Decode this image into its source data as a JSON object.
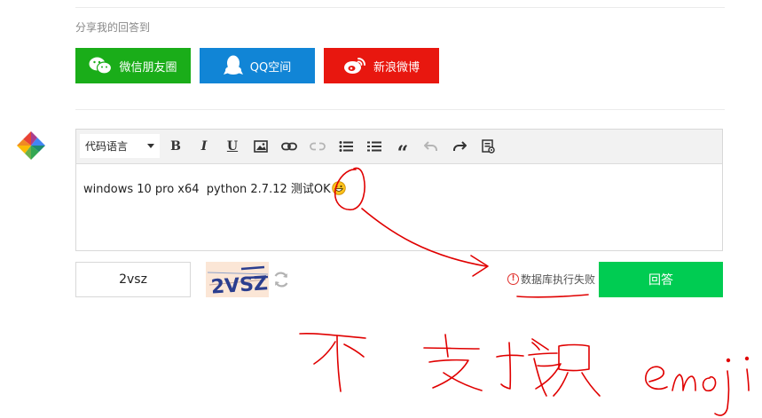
{
  "share": {
    "label": "分享我的回答到",
    "buttons": [
      {
        "label": "微信朋友圈",
        "icon": "wechat-icon",
        "color": "#1aad19"
      },
      {
        "label": "QQ空间",
        "icon": "qq-icon",
        "color": "#1185d6"
      },
      {
        "label": "新浪微博",
        "icon": "weibo-icon",
        "color": "#e8170f"
      }
    ]
  },
  "editor": {
    "code_language_label": "代码语言",
    "toolbar_icons": [
      "bold-icon",
      "italic-icon",
      "underline-icon",
      "image-icon",
      "link-icon",
      "unlink-icon",
      "bullet-list-icon",
      "numbered-list-icon",
      "quote-icon",
      "undo-icon",
      "redo-icon",
      "preview-icon"
    ],
    "bold_label": "B",
    "italic_label": "I",
    "underline_label": "U",
    "quote_label": "“",
    "content": "windows 10 pro x64  python 2.7.12 测试OK"
  },
  "captcha": {
    "input_value": "2vsz",
    "image_text": "2VSZ"
  },
  "error_message": "数据库执行失败",
  "submit_label": "回答",
  "annotation": {
    "color": "#e00000",
    "handwritten_text": "不支持 emoji"
  }
}
